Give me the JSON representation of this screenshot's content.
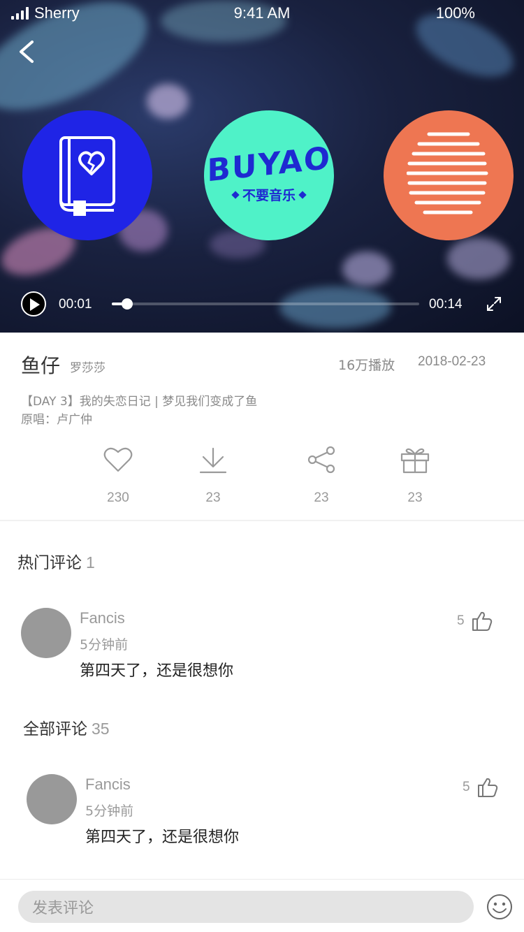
{
  "status_bar": {
    "carrier": "Sherry",
    "time": "9:41 AM",
    "battery": "100%"
  },
  "player": {
    "current_time": "00:01",
    "total_time": "00:14",
    "progress": 0.05
  },
  "covers": {
    "center_logo": "BUYAO",
    "center_sub": "不要音乐",
    "colors": {
      "left": "#1f24e6",
      "center": "#4ff2c8",
      "right": "#ee7652"
    }
  },
  "song": {
    "title": "鱼仔",
    "artist": "罗莎莎",
    "plays": "16万播放",
    "date": "2018-02-23",
    "description": "【DAY 3】我的失恋日记 | 梦见我们变成了鱼",
    "original": "原唱：卢广仲"
  },
  "actions": [
    {
      "icon": "heart-icon",
      "count": "230"
    },
    {
      "icon": "download-icon",
      "count": "23"
    },
    {
      "icon": "share-icon",
      "count": "23"
    },
    {
      "icon": "gift-icon",
      "count": "23"
    }
  ],
  "hot_comments": {
    "title": "热门评论",
    "count": "1",
    "items": [
      {
        "name": "Fancis",
        "time": "5分钟前",
        "text": "第四天了，还是很想你",
        "likes": "5"
      }
    ]
  },
  "all_comments": {
    "title": "全部评论",
    "count": "35",
    "items": [
      {
        "name": "Fancis",
        "time": "5分钟前",
        "text": "第四天了，还是很想你",
        "likes": "5"
      }
    ]
  },
  "bottom_bar": {
    "input_placeholder": "发表评论"
  }
}
